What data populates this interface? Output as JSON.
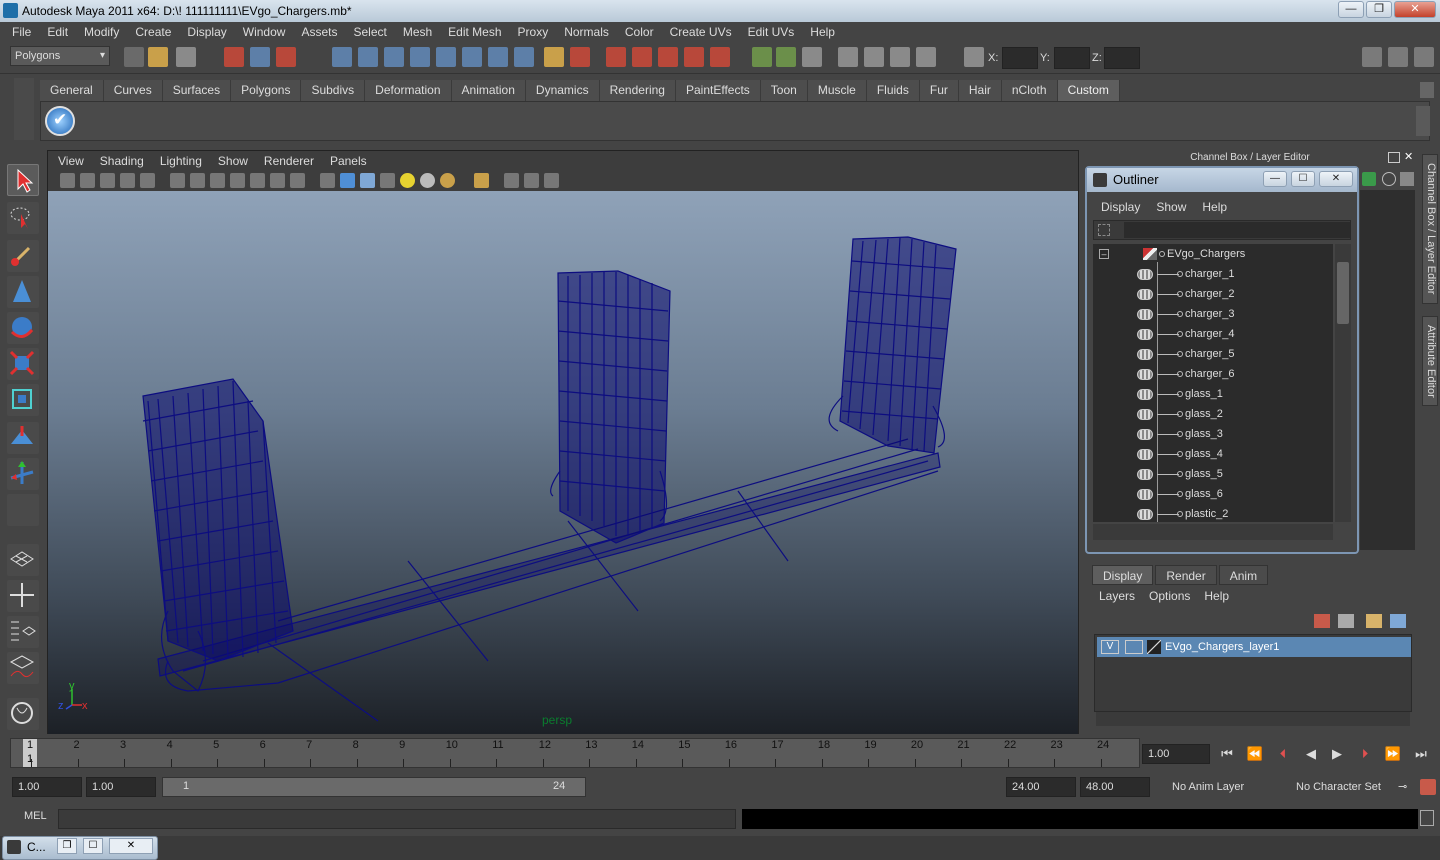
{
  "window": {
    "title": "Autodesk Maya 2011 x64: D:\\! 111111111\\EVgo_Chargers.mb*",
    "min": "—",
    "max": "❐",
    "close": "✕"
  },
  "menu": [
    "File",
    "Edit",
    "Modify",
    "Create",
    "Display",
    "Window",
    "Assets",
    "Select",
    "Mesh",
    "Edit Mesh",
    "Proxy",
    "Normals",
    "Color",
    "Create UVs",
    "Edit UVs",
    "Help"
  ],
  "status": {
    "mode": "Polygons",
    "x_label": "X:",
    "y_label": "Y:",
    "z_label": "Z:"
  },
  "shelf_tabs": [
    "General",
    "Curves",
    "Surfaces",
    "Polygons",
    "Subdivs",
    "Deformation",
    "Animation",
    "Dynamics",
    "Rendering",
    "PaintEffects",
    "Toon",
    "Muscle",
    "Fluids",
    "Fur",
    "Hair",
    "nCloth",
    "Custom"
  ],
  "active_shelf_tab": "Custom",
  "panel": {
    "menu": [
      "View",
      "Shading",
      "Lighting",
      "Show",
      "Renderer",
      "Panels"
    ],
    "camera": "persp",
    "axis_y": "y",
    "axis_x": "x",
    "axis_z": "z"
  },
  "channel_box_title": "Channel Box / Layer Editor",
  "side_tabs": {
    "channel": "Channel Box / Layer Editor",
    "attr": "Attribute Editor"
  },
  "outliner": {
    "title": "Outliner",
    "menu": [
      "Display",
      "Show",
      "Help"
    ],
    "root": "EVgo_Chargers",
    "items": [
      "charger_1",
      "charger_2",
      "charger_3",
      "charger_4",
      "charger_5",
      "charger_6",
      "glass_1",
      "glass_2",
      "glass_3",
      "glass_4",
      "glass_5",
      "glass_6",
      "plastic_2"
    ]
  },
  "layer_editor": {
    "tabs": [
      "Display",
      "Render",
      "Anim"
    ],
    "active_tab": "Display",
    "menu": [
      "Layers",
      "Options",
      "Help"
    ],
    "layer_visible": "V",
    "layer_name": "EVgo_Chargers_layer1"
  },
  "timeline": {
    "ticks": [
      1,
      2,
      3,
      4,
      5,
      6,
      7,
      8,
      9,
      10,
      11,
      12,
      13,
      14,
      15,
      16,
      17,
      18,
      19,
      20,
      21,
      22,
      23,
      24
    ],
    "current_frame": "1",
    "current_time_field": "1.00"
  },
  "range": {
    "start_time": "1.00",
    "playback_start": "1.00",
    "range_start": "1",
    "range_end": "24",
    "playback_end": "24.00",
    "end_time": "48.00",
    "anim_layer": "No Anim Layer",
    "character_set": "No Character Set"
  },
  "mel": {
    "label": "MEL"
  },
  "taskbar": {
    "item": "C..."
  },
  "colors": {
    "accent": "#5b87b3",
    "wireframe": "#0a0a7a",
    "camera_label": "#0a7d2e"
  }
}
